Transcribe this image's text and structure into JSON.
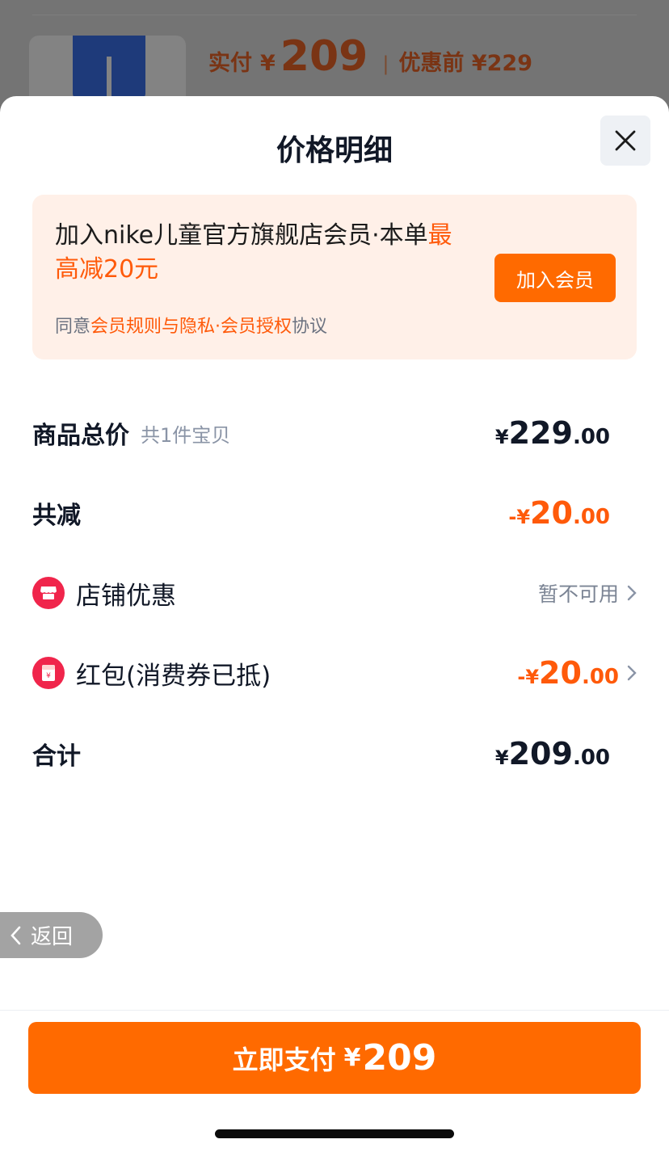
{
  "background_page": {
    "paid_label": "实付",
    "currency": "¥",
    "paid_amount": "209",
    "separator": "|",
    "original_label": "优惠前 ¥229"
  },
  "sheet": {
    "title": "价格明细",
    "close_icon": "close-icon"
  },
  "promo": {
    "text_prefix": "加入nike儿童官方旗舰店会员·本单",
    "text_highlight": "最高减20元",
    "join_button": "加入会员",
    "agree_prefix": "同意",
    "agree_link": "会员规则与隐私·会员授权",
    "agree_suffix": "协议"
  },
  "rows": {
    "goods_total": {
      "label": "商品总价",
      "sub": "共1件宝贝",
      "currency": "¥",
      "int": "229",
      "dec": ".00"
    },
    "total_discount": {
      "label": "共减",
      "sign": "-",
      "currency": "¥",
      "int": "20",
      "dec": ".00"
    },
    "store_discount": {
      "label": "店铺优惠",
      "value": "暂不可用",
      "icon": "store-icon"
    },
    "red_packet": {
      "label": "红包(消费券已抵)",
      "sign": "-",
      "currency": "¥",
      "int": "20",
      "dec": ".00",
      "icon": "red-packet-icon"
    },
    "sum": {
      "label": "合计",
      "currency": "¥",
      "int": "209",
      "dec": ".00"
    }
  },
  "back_button": {
    "label": "返回"
  },
  "pay_button": {
    "label": "立即支付",
    "currency": "¥",
    "amount": "209"
  },
  "colors": {
    "accent": "#ff6a00",
    "discount": "#ff5a0a",
    "text": "#111827",
    "promo_bg": "#fff0e8"
  }
}
